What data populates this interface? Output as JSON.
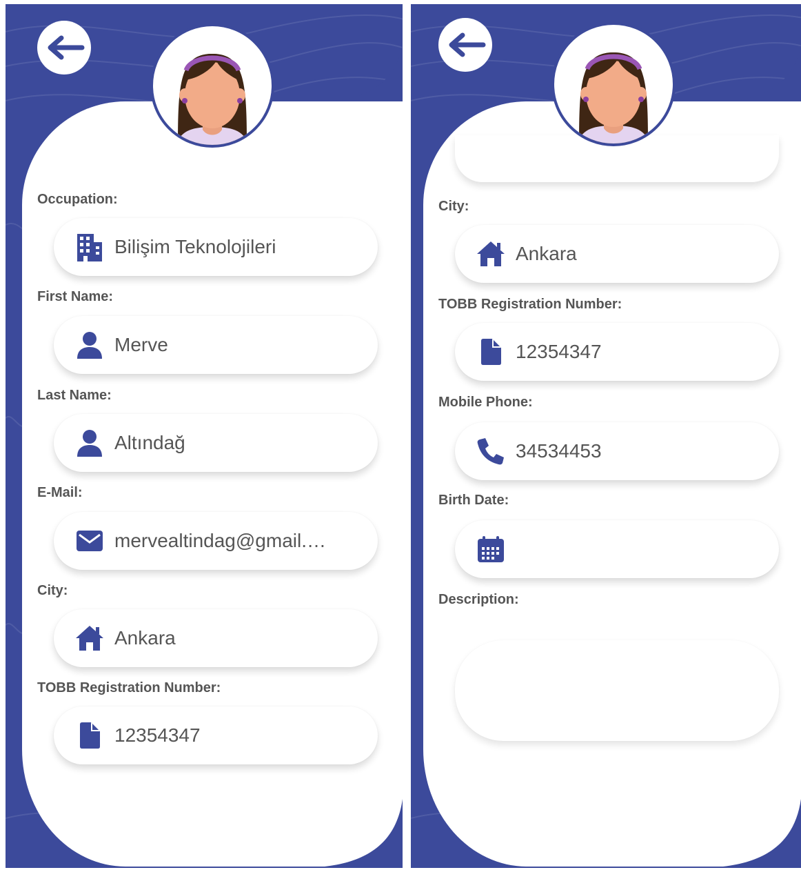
{
  "colors": {
    "primary": "#3c4a9b",
    "label": "#555555",
    "icon": "#3c4a9b"
  },
  "left": {
    "fields": [
      {
        "label": "Occupation:",
        "value": "Bilişim Teknolojileri",
        "icon": "building-icon"
      },
      {
        "label": "First Name:",
        "value": "Merve",
        "icon": "user-icon"
      },
      {
        "label": "Last Name:",
        "value": "Altındağ",
        "icon": "user-icon"
      },
      {
        "label": "E-Mail:",
        "value": "mervealtindag@gmail.…",
        "icon": "envelope-icon"
      },
      {
        "label": "City:",
        "value": "Ankara",
        "icon": "home-icon"
      },
      {
        "label": "TOBB Registration Number:",
        "value": "12354347",
        "icon": "file-icon"
      }
    ]
  },
  "right": {
    "fields": [
      {
        "label": "City:",
        "value": "Ankara",
        "icon": "home-icon"
      },
      {
        "label": "TOBB Registration Number:",
        "value": "12354347",
        "icon": "file-icon"
      },
      {
        "label": "Mobile Phone:",
        "value": "34534453",
        "icon": "phone-icon"
      },
      {
        "label": "Birth Date:",
        "value": "",
        "icon": "calendar-icon"
      }
    ],
    "description_label": "Description:",
    "description_value": ""
  }
}
